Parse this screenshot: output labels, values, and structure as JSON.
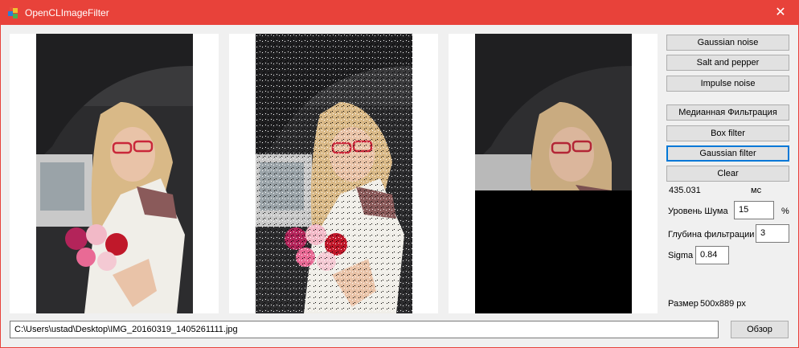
{
  "window": {
    "title": "OpenCLImageFilter",
    "close_symbol": "✕"
  },
  "buttons": {
    "gaussian_noise": "Gaussian noise",
    "salt_pepper": "Salt and pepper",
    "impulse_noise": "Impulse noise",
    "median_filter": "Медианная Фильтрация",
    "box_filter": "Box filter",
    "gaussian_filter": "Gaussian filter",
    "clear": "Clear",
    "browse": "Обзор"
  },
  "timing": {
    "value": "435.031",
    "unit": "мс"
  },
  "noise_level": {
    "label": "Уровень Шума",
    "value": "15",
    "unit": "%"
  },
  "filter_depth": {
    "label": "Глубина фильтрации",
    "value": "3"
  },
  "sigma": {
    "label": "Sigma",
    "value": "0.84"
  },
  "size": {
    "label": "Размер",
    "value": "500x889 px"
  },
  "file_path": "C:\\Users\\ustad\\Desktop\\IMG_20160319_1405261111.jpg",
  "panels": {
    "original": "Original photo: woman with red glasses in car holding roses",
    "noisy": "Same photo with salt-and-pepper noise applied",
    "filtered": "Filtered photo, upper portion processed, lower part black"
  },
  "colors": {
    "title_bar": "#e8423a",
    "focus": "#0078d7",
    "client_bg": "#f0f0f0"
  }
}
